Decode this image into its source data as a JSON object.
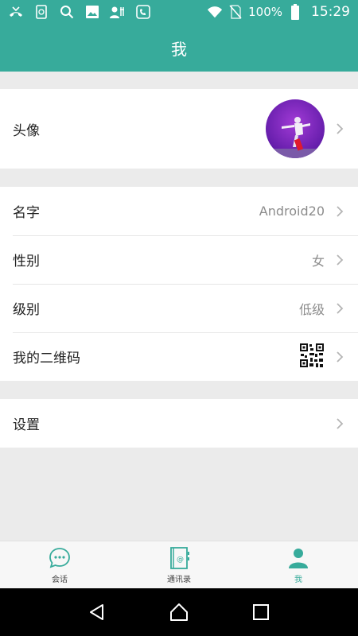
{
  "status_bar": {
    "battery_percent": "100%",
    "time": "15:29",
    "icons": [
      "missed-call-icon",
      "sim-icon",
      "search-icon",
      "image-icon",
      "contacts-icon",
      "voip-icon",
      "wifi-icon",
      "no-sim-icon",
      "battery-icon"
    ]
  },
  "header": {
    "title": "我"
  },
  "profile": {
    "avatar_label": "头像",
    "rows": [
      {
        "label": "名字",
        "value": "Android20"
      },
      {
        "label": "性别",
        "value": "女"
      },
      {
        "label": "级别",
        "value": "低级"
      },
      {
        "label": "我的二维码",
        "value": ""
      }
    ],
    "settings_label": "设置"
  },
  "bottom_nav": {
    "tabs": [
      {
        "label": "会话",
        "icon": "chat-icon",
        "active": false
      },
      {
        "label": "通讯录",
        "icon": "contacts-book-icon",
        "active": false
      },
      {
        "label": "我",
        "icon": "person-icon",
        "active": true
      }
    ]
  },
  "colors": {
    "primary": "#37ab9b",
    "background": "#ebebeb"
  }
}
